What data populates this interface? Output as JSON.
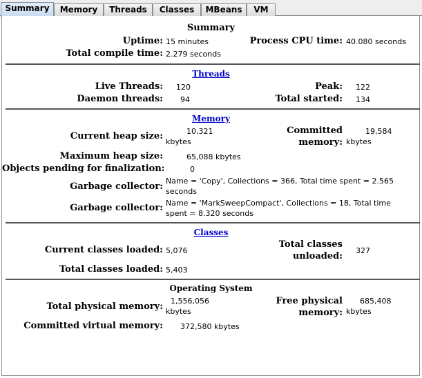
{
  "tabs": [
    "Summary",
    "Memory",
    "Threads",
    "Classes",
    "MBeans",
    "VM"
  ],
  "summary": {
    "heading": "Summary",
    "uptime_label": "Uptime:",
    "uptime_value": "15 minutes",
    "cpu_label": "Process CPU time:",
    "cpu_value": "40.080 seconds",
    "compile_label": "Total compile time:",
    "compile_value": "2.279 seconds"
  },
  "threads": {
    "heading": "Threads",
    "live_label": "Live Threads:",
    "live_value": "120",
    "peak_label": "Peak:",
    "peak_value": "122",
    "daemon_label": "Daemon threads:",
    "daemon_value": "94",
    "started_label": "Total started:",
    "started_value": "134"
  },
  "memory": {
    "heading": "Memory",
    "heap_label": "Current heap size:",
    "heap_value": "10,321",
    "heap_unit": "kbytes",
    "committed_label_1": "Committed",
    "committed_label_2": "memory:",
    "committed_value": "19,584",
    "committed_unit": "kbytes",
    "max_heap_label": "Maximum heap size:",
    "max_heap_value": "65,088 kbytes",
    "pending_label": "Objects pending for finalization:",
    "pending_value": "0",
    "gc1_label": "Garbage collector:",
    "gc1_value": "Name = 'Copy', Collections = 366, Total time spent = 2.565 seconds",
    "gc2_label": "Garbage collector:",
    "gc2_value": "Name = 'MarkSweepCompact', Collections = 18, Total time spent = 8.320 seconds"
  },
  "classes": {
    "heading": "Classes",
    "current_label": "Current classes loaded:",
    "current_value": "5,076",
    "unloaded_label_1": "Total classes",
    "unloaded_label_2": "unloaded:",
    "unloaded_value": "327",
    "total_label": "Total classes loaded:",
    "total_value": "5,403"
  },
  "os": {
    "heading": "Operating System",
    "phys_label": "Total physical memory:",
    "phys_value": "1,556,056",
    "phys_unit": "kbytes",
    "free_label_1": "Free physical",
    "free_label_2": "memory:",
    "free_value": "685,408",
    "free_unit": "kbytes",
    "virt_label": "Committed virtual memory:",
    "virt_value": "372,580 kbytes"
  }
}
